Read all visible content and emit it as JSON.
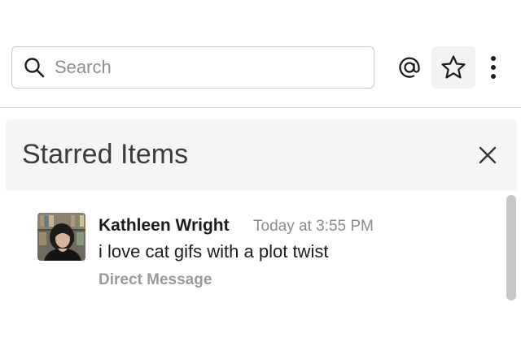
{
  "search": {
    "placeholder": "Search"
  },
  "header_icons": [
    "search-icon",
    "mention-icon",
    "star-icon",
    "more-vertical-icon"
  ],
  "panel": {
    "title": "Starred Items",
    "close_icon": "close-icon"
  },
  "starred_items": [
    {
      "sender": "Kathleen Wright",
      "timestamp": "Today at 3:55 PM",
      "text": "i love cat gifs with a plot twist",
      "source": "Direct Message"
    }
  ],
  "colors": {
    "text": "#1d1c1d",
    "muted": "#8b8b8b",
    "panel_bg": "#f5f5f5",
    "active_btn_bg": "#f2f2f2"
  }
}
